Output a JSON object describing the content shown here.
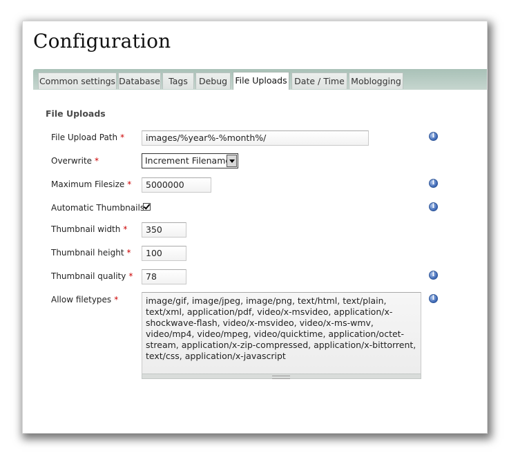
{
  "page": {
    "title": "Configuration"
  },
  "tabs": [
    {
      "label": "Common settings",
      "active": false
    },
    {
      "label": "Database",
      "active": false
    },
    {
      "label": "Tags",
      "active": false
    },
    {
      "label": "Debug",
      "active": false
    },
    {
      "label": "File Uploads",
      "active": true
    },
    {
      "label": "Date / Time",
      "active": false
    },
    {
      "label": "Moblogging",
      "active": false
    }
  ],
  "section": {
    "title": "File Uploads"
  },
  "fields": {
    "upload_path": {
      "label": "File Upload Path",
      "required": "*",
      "value": "images/%year%-%month%/"
    },
    "overwrite": {
      "label": "Overwrite",
      "required": "*",
      "value": "Increment Filename"
    },
    "max_filesize": {
      "label": "Maximum Filesize",
      "required": "*",
      "value": "5000000"
    },
    "auto_thumbnails": {
      "label": "Automatic Thumbnails",
      "checked": true
    },
    "thumb_width": {
      "label": "Thumbnail width",
      "required": "*",
      "value": "350"
    },
    "thumb_height": {
      "label": "Thumbnail height",
      "required": "*",
      "value": "100"
    },
    "thumb_quality": {
      "label": "Thumbnail quality",
      "required": "*",
      "value": "78"
    },
    "filetypes": {
      "label": "Allow filetypes",
      "required": "*",
      "value": "image/gif, image/jpeg, image/png, text/html, text/plain, text/xml, application/pdf, video/x-msvideo, application/x-shockwave-flash, video/x-msvideo, video/x-ms-wmv, video/mp4, video/mpeg, video/quicktime, application/octet-stream, application/x-zip-compressed, application/x-bittorrent, text/css, application/x-javascript"
    }
  },
  "icons": {
    "info": "info-icon",
    "info_glyph": "i"
  },
  "colors": {
    "tabbar": "#a9c1b7",
    "required": "#cc0000",
    "info": "#3b66b4"
  }
}
